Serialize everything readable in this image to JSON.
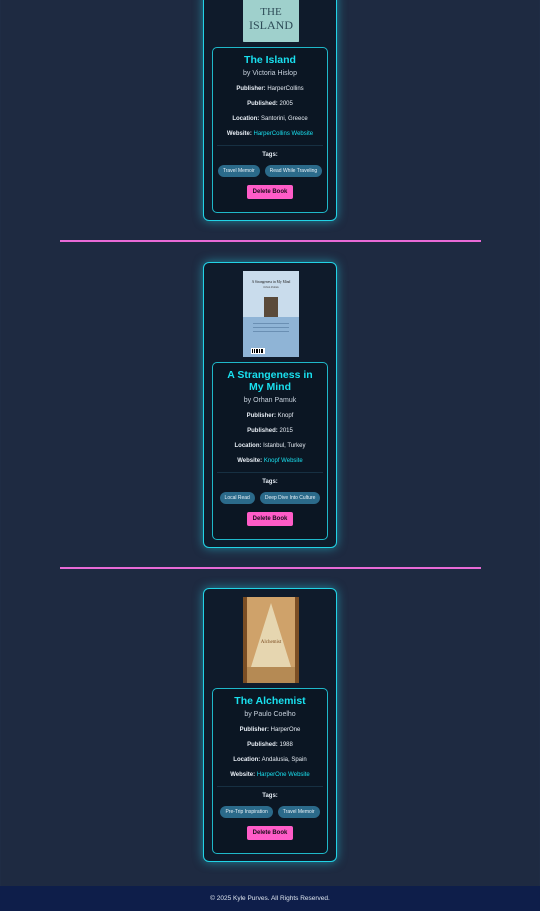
{
  "books": [
    {
      "title": "The Island",
      "author": "by Victoria Hislop",
      "publisher": "HarperCollins",
      "published": "2005",
      "location": "Santorini, Greece",
      "website_label": "HarperCollins Website",
      "tags": [
        "Travel Memoir",
        "Read While Traveling"
      ],
      "cover_text": "THE ISLAND"
    },
    {
      "title": "A Strangeness in My Mind",
      "author": "by Orhan Pamuk",
      "publisher": "Knopf",
      "published": "2015",
      "location": "Istanbul, Turkey",
      "website_label": "Knopf Website",
      "tags": [
        "Local Read",
        "Deep Dive Into Culture"
      ],
      "cover_text": "A Strangeness in My Mind"
    },
    {
      "title": "The Alchemist",
      "author": "by Paulo Coelho",
      "publisher": "HarperOne",
      "published": "1988",
      "location": "Andalusia, Spain",
      "website_label": "HarperOne Website",
      "tags": [
        "Pre-Trip Inspiration",
        "Travel Memoir"
      ],
      "cover_text": "Alchemist"
    }
  ],
  "labels": {
    "publisher": "Publisher:",
    "published": "Published:",
    "location": "Location:",
    "website": "Website:",
    "tags": "Tags:",
    "delete": "Delete Book"
  },
  "footer": {
    "text": "© 2025 Kyle Purves. All Rights Reserved."
  },
  "colors": {
    "accent": "#19e0ef",
    "delete": "#ff5cc8",
    "divider": "#e86ad6",
    "tag": "#2b6a8a"
  }
}
